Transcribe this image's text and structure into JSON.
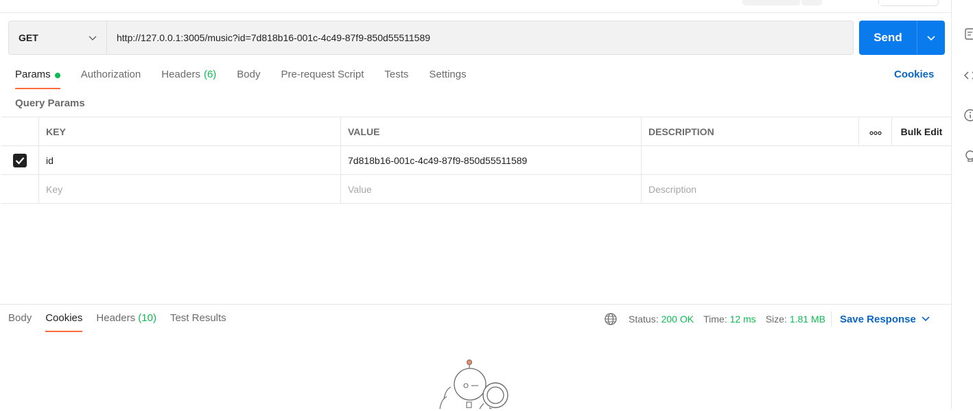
{
  "request": {
    "method": "GET",
    "url": "http://127.0.0.1:3005/music?id=7d818b16-001c-4c49-87f9-850d55511589",
    "send_label": "Send"
  },
  "request_tabs": [
    {
      "label": "Params",
      "count": ""
    },
    {
      "label": "Authorization",
      "count": ""
    },
    {
      "label": "Headers",
      "count": "(6)"
    },
    {
      "label": "Body",
      "count": ""
    },
    {
      "label": "Pre-request Script",
      "count": ""
    },
    {
      "label": "Tests",
      "count": ""
    },
    {
      "label": "Settings",
      "count": ""
    }
  ],
  "cookies_link": "Cookies",
  "query_params": {
    "title": "Query Params",
    "headers": {
      "key": "KEY",
      "value": "VALUE",
      "description": "DESCRIPTION",
      "bulk_edit": "Bulk Edit",
      "more": "ooo"
    },
    "rows": [
      {
        "key": "id",
        "value": "7d818b16-001c-4c49-87f9-850d55511589",
        "description": "",
        "checked": true
      }
    ],
    "placeholders": {
      "key": "Key",
      "value": "Value",
      "description": "Description"
    }
  },
  "response": {
    "tabs": [
      {
        "label": "Body",
        "count": ""
      },
      {
        "label": "Cookies",
        "count": ""
      },
      {
        "label": "Headers",
        "count": "(10)"
      },
      {
        "label": "Test Results",
        "count": ""
      }
    ],
    "active_tab": "Cookies",
    "status_label": "Status:",
    "status_value": "200 OK",
    "time_label": "Time:",
    "time_value": "12 ms",
    "size_label": "Size:",
    "size_value": "1.81 MB",
    "save_label": "Save Response"
  },
  "colors": {
    "accent": "#ff6c37",
    "send": "#097bed",
    "success": "#0cbb52",
    "link": "#0a65c5"
  }
}
